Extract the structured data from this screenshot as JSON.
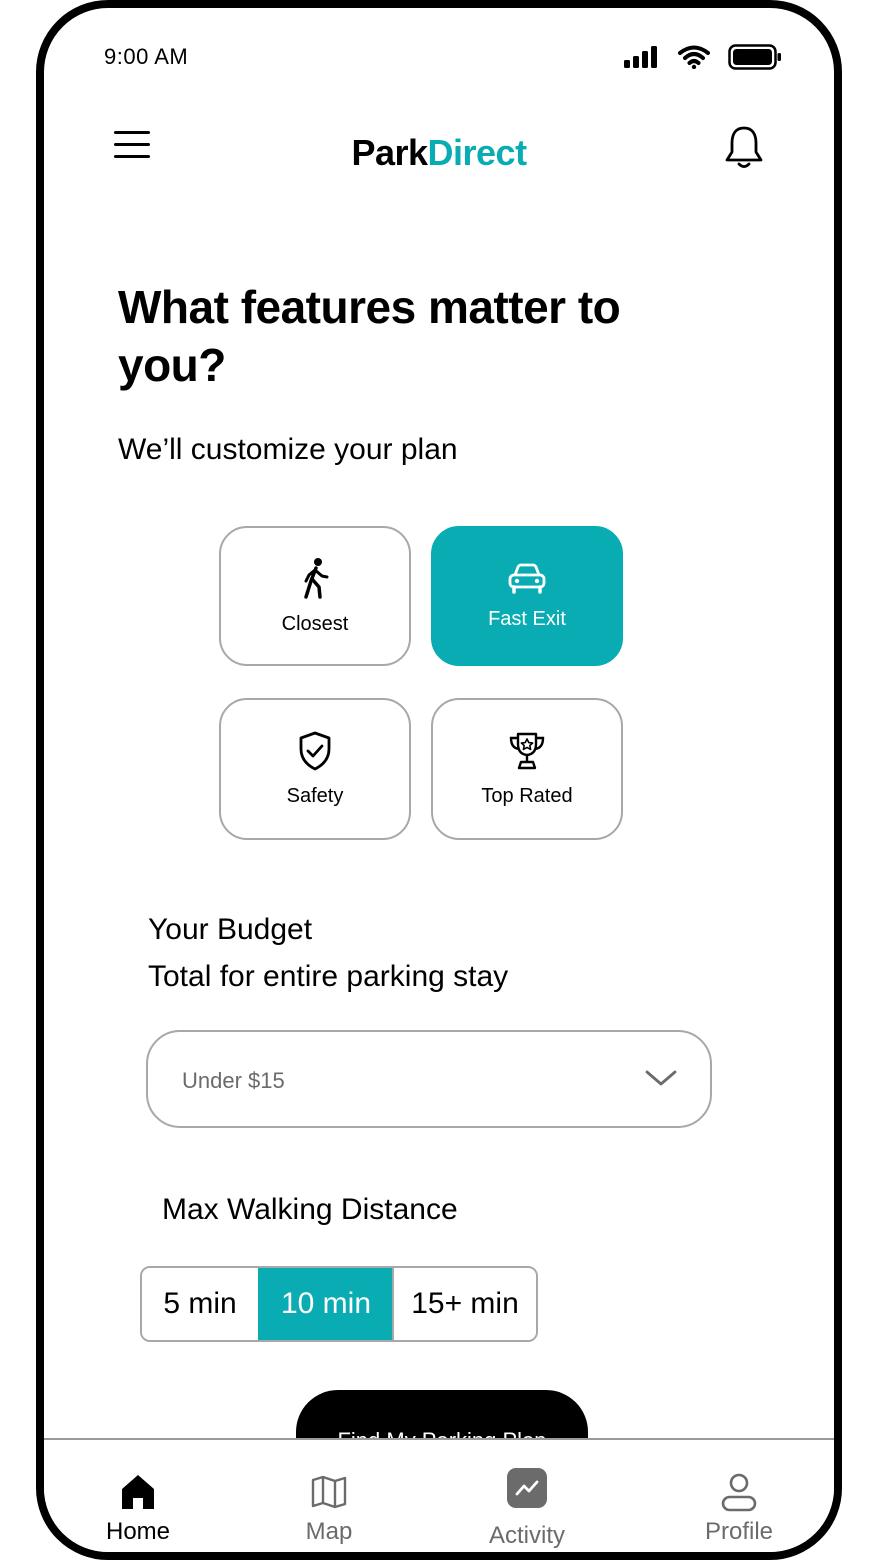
{
  "status_bar": {
    "time": "9:00 AM"
  },
  "header": {
    "brand_part1": "Park",
    "brand_part2": "Direct"
  },
  "main": {
    "title": "What features matter to you?",
    "subtitle": "We’ll customize your plan",
    "features": [
      {
        "label": "Closest",
        "icon": "walking-person-icon",
        "selected": false
      },
      {
        "label": "Fast Exit",
        "icon": "car-icon",
        "selected": true
      },
      {
        "label": "Safety",
        "icon": "shield-check-icon",
        "selected": false
      },
      {
        "label": "Top Rated",
        "icon": "trophy-icon",
        "selected": false
      }
    ],
    "budget": {
      "title": "Your Budget",
      "subtitle": "Total for entire parking stay",
      "selected": "Under $15"
    },
    "walking": {
      "title": "Max Walking Distance",
      "options": [
        "5 min",
        "10 min",
        "15+ min"
      ],
      "selected": "10 min"
    },
    "cta_label": "Find My Parking Plan"
  },
  "nav": {
    "items": [
      {
        "label": "Home",
        "icon": "home-icon",
        "active": true
      },
      {
        "label": "Map",
        "icon": "map-icon",
        "active": false
      },
      {
        "label": "Activity",
        "icon": "activity-icon",
        "active": false
      },
      {
        "label": "Profile",
        "icon": "profile-icon",
        "active": false
      }
    ]
  },
  "colors": {
    "accent": "#0aacb4",
    "border": "#a8a8a8",
    "text": "#000000",
    "muted": "#6b6b6b"
  }
}
